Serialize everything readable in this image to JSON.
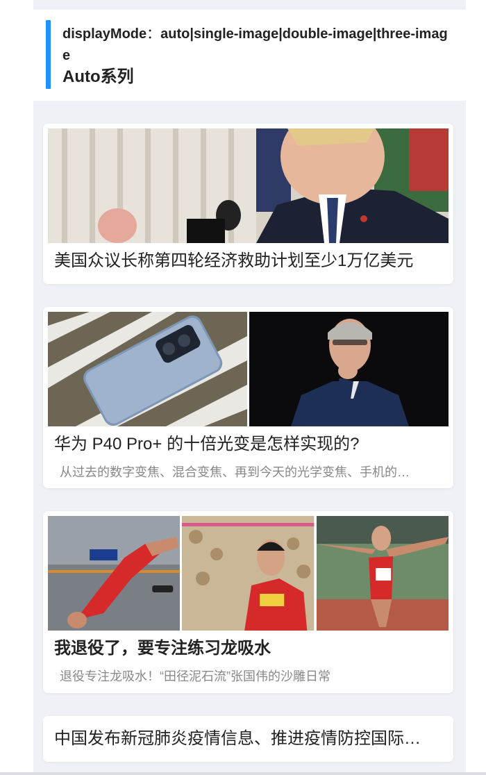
{
  "header": {
    "mode_label": "displayMode",
    "mode_sep": "：",
    "mode_values": "auto|single-image|double-image|three-image",
    "title": "Auto系列"
  },
  "cards": [
    {
      "layout": "single-image",
      "title": "美国众议长称第四轮经济救助计划至少1万亿美元",
      "images": [
        "politician-speaking-photo"
      ]
    },
    {
      "layout": "double-image",
      "title": "华为 P40 Pro+ 的十倍光变是怎样实现的?",
      "summary": "从过去的数字变焦、混合变焦、再到今天的光学变焦、手机的…",
      "images": [
        "phone-photo",
        "man-portrait-photo"
      ]
    },
    {
      "layout": "three-image",
      "title": "我退役了，要专注练习龙吸水",
      "summary": "退役专注龙吸水！“田径泥石流”张国伟的沙雕日常",
      "images": [
        "high-jump-photo",
        "athlete-sitting-photo",
        "athlete-celebrating-photo"
      ]
    },
    {
      "layout": "text-only",
      "title": "中国发布新冠肺炎疫情信息、推进疫情防控国际…"
    }
  ]
}
